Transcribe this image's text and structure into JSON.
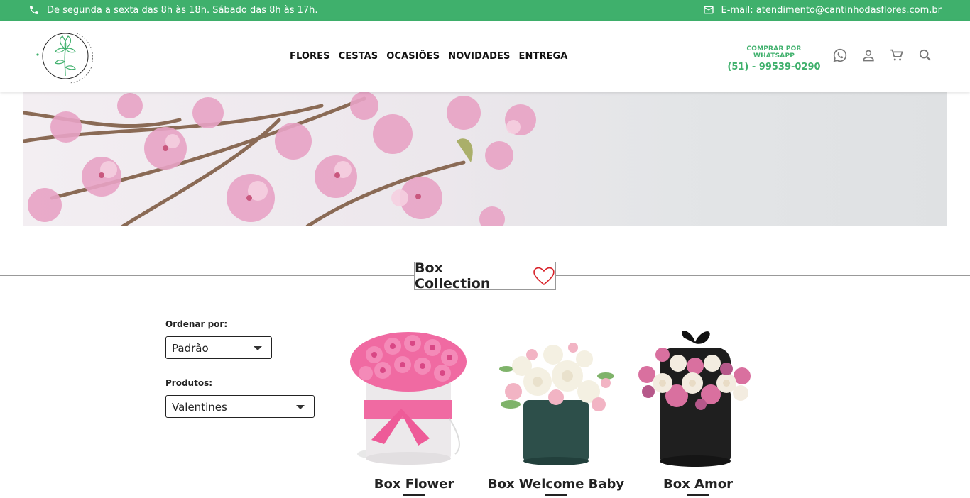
{
  "topbar": {
    "hours": "De segunda a sexta das 8h às 18h. Sábado das 8h às 17h.",
    "email": "E-mail: atendimento@cantinhodasflores.com.br"
  },
  "nav": {
    "items": [
      "FLORES",
      "CESTAS",
      "OCASIÕES",
      "NOVIDADES",
      "ENTREGA"
    ]
  },
  "whatsapp": {
    "label": "COMPRAR POR WHATSAPP",
    "number": "(51) - 99539-0290"
  },
  "section": {
    "title": "Box Collection"
  },
  "filters": {
    "sort_label": "Ordenar por:",
    "sort_value": "Padrão",
    "products_label": "Produtos:",
    "products_value": "Valentines"
  },
  "products": [
    {
      "name": "Box Flower"
    },
    {
      "name": "Box Welcome Baby"
    },
    {
      "name": "Box Amor"
    }
  ],
  "colors": {
    "accent": "#3fb06c",
    "heart": "#d8232a"
  },
  "icons": [
    "phone-icon",
    "mail-icon",
    "whatsapp-icon",
    "user-icon",
    "cart-icon",
    "search-icon",
    "heart-icon"
  ]
}
